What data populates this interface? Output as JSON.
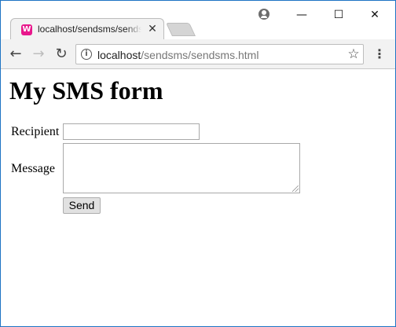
{
  "browser": {
    "tab": {
      "favicon_glyph": "W",
      "title": "localhost/sendsms/sendsms.html",
      "close_glyph": "✕"
    },
    "window_controls": {
      "minimize": "—",
      "maximize": "☐",
      "close": "✕"
    },
    "nav": {
      "back": "←",
      "forward": "→",
      "reload": "↻"
    },
    "address": {
      "info_glyph": "i",
      "host": "localhost",
      "path": "/sendsms/sendsms.html"
    },
    "star_glyph": "☆",
    "menu_glyph": "⋮"
  },
  "page": {
    "title": "My SMS form",
    "form": {
      "recipient_label": "Recipient",
      "recipient_value": "",
      "message_label": "Message",
      "message_value": "",
      "send_label": "Send"
    }
  },
  "colors": {
    "accent": "#1e74c4",
    "favicon": "#e8188c"
  }
}
